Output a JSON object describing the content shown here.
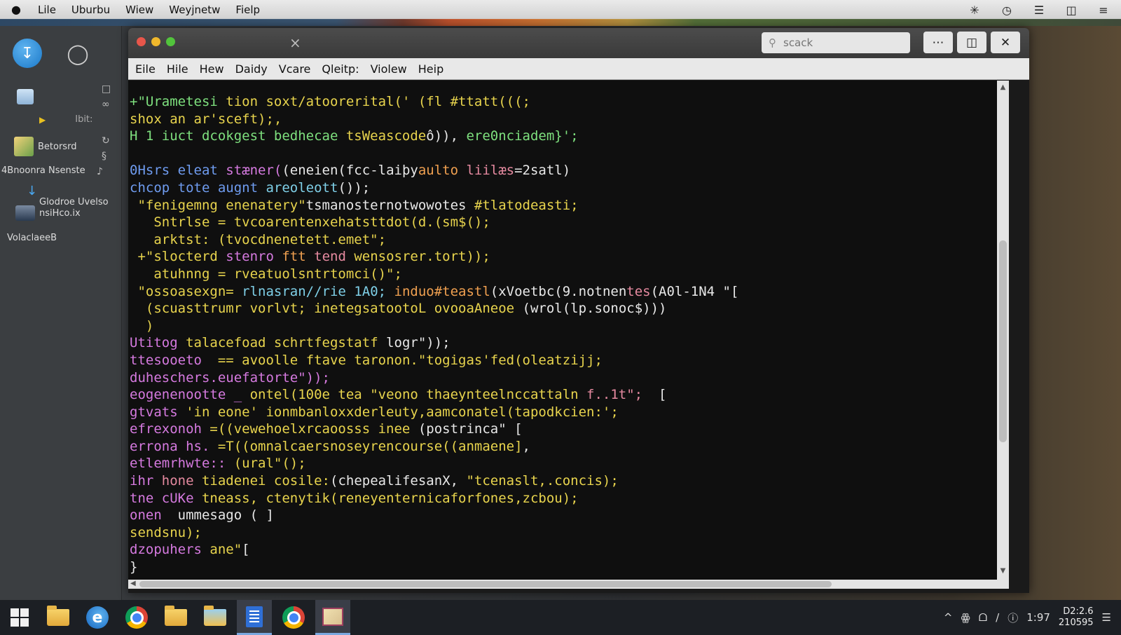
{
  "menubar": {
    "items": [
      "Lile",
      "Uburbu",
      "Wiew",
      "Weyjnetw",
      "Fielp"
    ]
  },
  "sidebar": {
    "items": [
      {
        "label": "Ibit:"
      },
      {
        "label": "Betorsrd"
      },
      {
        "label": "4Bnoonra Nsenste"
      },
      {
        "label": "Glodroe Uvelso"
      },
      {
        "label": "nsiHco.ix"
      },
      {
        "label": "VolaclaeeB"
      }
    ]
  },
  "window": {
    "search": {
      "placeholder": "scack"
    },
    "menu": [
      "Eile",
      "Hile",
      "Hew",
      "Daidy",
      "Vcare",
      "Qleitp:",
      "Violew",
      "Heip"
    ]
  },
  "code": {
    "lines": [
      [
        {
          "t": "+\"Urametesi ",
          "c": "g"
        },
        {
          "t": "tion ",
          "c": "y"
        },
        {
          "t": "soxt/atoorerital('",
          "c": "y"
        },
        {
          "t": " (fl #ttatt(((;",
          "c": "y"
        }
      ],
      [
        {
          "t": "shox an ar'sceft);,",
          "c": "y"
        }
      ],
      [
        {
          "t": "H 1 iuct ",
          "c": "g"
        },
        {
          "t": "dcokgest ",
          "c": "g"
        },
        {
          "t": "bedhecae ",
          "c": "g"
        },
        {
          "t": "tsWeascode",
          "c": "y"
        },
        {
          "t": "ô)), ",
          "c": "w"
        },
        {
          "t": "ere0nciadem}';",
          "c": "g"
        }
      ],
      [
        {
          "t": "",
          "c": "w"
        }
      ],
      [
        {
          "t": "0Hsrs eleat ",
          "c": "b"
        },
        {
          "t": "stæner(",
          "c": "m"
        },
        {
          "t": "(eneien(fcc-laiþy",
          "c": "w"
        },
        {
          "t": "aulto ",
          "c": "o"
        },
        {
          "t": "liilæs",
          "c": "p"
        },
        {
          "t": "=2satl)",
          "c": "w"
        }
      ],
      [
        {
          "t": "chcop ",
          "c": "b"
        },
        {
          "t": "tote augnt ",
          "c": "b"
        },
        {
          "t": "areoleott",
          "c": "c"
        },
        {
          "t": "());",
          "c": "w"
        }
      ],
      [
        {
          "t": " \"fenigemng ",
          "c": "y"
        },
        {
          "t": "enenatery\"",
          "c": "y"
        },
        {
          "t": "tsmanosternotwowotes ",
          "c": "w"
        },
        {
          "t": "#tlatodeasti;",
          "c": "y"
        }
      ],
      [
        {
          "t": "   Sntrlse = ",
          "c": "y"
        },
        {
          "t": "tvcoarentenxehatsttdot(d.(sm$();",
          "c": "y"
        }
      ],
      [
        {
          "t": "   arktst: ",
          "c": "y"
        },
        {
          "t": "(tvocdnenetett.emet\";",
          "c": "y"
        }
      ],
      [
        {
          "t": " +\"slocterd ",
          "c": "y"
        },
        {
          "t": "stenro ",
          "c": "m"
        },
        {
          "t": "ftt ",
          "c": "o"
        },
        {
          "t": "tend ",
          "c": "p"
        },
        {
          "t": "wensosrer.tort));",
          "c": "y"
        }
      ],
      [
        {
          "t": "   atuhnng = ",
          "c": "y"
        },
        {
          "t": "rveatuolsntrtomci()\";",
          "c": "y"
        }
      ],
      [
        {
          "t": " \"ossoasexgn= ",
          "c": "y"
        },
        {
          "t": "rlnasran//rie ",
          "c": "c"
        },
        {
          "t": "1A0; ",
          "c": "c"
        },
        {
          "t": "induo#teastl",
          "c": "o"
        },
        {
          "t": "(xVoetbc(9.notnen",
          "c": "w"
        },
        {
          "t": "tes",
          "c": "p"
        },
        {
          "t": "(A0l-1N4 \"[",
          "c": "w"
        }
      ],
      [
        {
          "t": "  (scuasttrumr ",
          "c": "y"
        },
        {
          "t": "vorlvt; ",
          "c": "y"
        },
        {
          "t": "inetegsatootoL ",
          "c": "y"
        },
        {
          "t": "ovooaAneoe ",
          "c": "y"
        },
        {
          "t": "(wrol(lp.sonoc$)))",
          "c": "w"
        }
      ],
      [
        {
          "t": "  )",
          "c": "y"
        }
      ],
      [
        {
          "t": "Utitog ",
          "c": "m"
        },
        {
          "t": "talacefoad ",
          "c": "y"
        },
        {
          "t": "schrtfegstatf ",
          "c": "y"
        },
        {
          "t": "logr\"));",
          "c": "w"
        }
      ],
      [
        {
          "t": "ttesooeto  ",
          "c": "m"
        },
        {
          "t": "== avoolle ",
          "c": "y"
        },
        {
          "t": "ftave ",
          "c": "y"
        },
        {
          "t": "taronon.",
          "c": "y"
        },
        {
          "t": "\"togigas",
          "c": "y"
        },
        {
          "t": "'fed(oleatzijj;",
          "c": "y"
        }
      ],
      [
        {
          "t": "duheschers.euefatorte\"));",
          "c": "m"
        }
      ],
      [
        {
          "t": "eogenenootte _ ",
          "c": "m"
        },
        {
          "t": "ontel(",
          "c": "y"
        },
        {
          "t": "100e tea ",
          "c": "y"
        },
        {
          "t": "\"veono ",
          "c": "y"
        },
        {
          "t": "thaeynteelnccattaln ",
          "c": "y"
        },
        {
          "t": "f..1t\";",
          "c": "p"
        },
        {
          "t": "  [",
          "c": "w"
        }
      ],
      [
        {
          "t": "gtvats ",
          "c": "m"
        },
        {
          "t": "'in eone' ",
          "c": "y"
        },
        {
          "t": "ionmbanloxxderleuty,",
          "c": "y"
        },
        {
          "t": "aamconatel(tapodkcien:';",
          "c": "y"
        }
      ],
      [
        {
          "t": "efrexonoh ",
          "c": "m"
        },
        {
          "t": "=((vewehoelxrcaoosss ",
          "c": "y"
        },
        {
          "t": "inee ",
          "c": "y"
        },
        {
          "t": "(postrinca\" [",
          "c": "w"
        }
      ],
      [
        {
          "t": "errona ",
          "c": "m"
        },
        {
          "t": "hs. ",
          "c": "m"
        },
        {
          "t": "=T((omnalcaersnoseyrencourse((anmaene]",
          "c": "y"
        },
        {
          "t": ",",
          "c": "w"
        }
      ],
      [
        {
          "t": "etlemrhwte:: ",
          "c": "m"
        },
        {
          "t": "(ural\"();",
          "c": "y"
        }
      ],
      [
        {
          "t": "ihr ",
          "c": "m"
        },
        {
          "t": "hone ",
          "c": "p"
        },
        {
          "t": "tiadenei ",
          "c": "y"
        },
        {
          "t": "cosile:",
          "c": "y"
        },
        {
          "t": "(chepealifesanX,",
          "c": "w"
        },
        {
          "t": " \"tcenaslt,.concis);",
          "c": "y"
        }
      ],
      [
        {
          "t": "tne ",
          "c": "m"
        },
        {
          "t": "cUKe ",
          "c": "m"
        },
        {
          "t": "tneass",
          "c": "y"
        },
        {
          "t": ", ctenytik(reneyenternicaforfones,zcbou);",
          "c": "y"
        }
      ],
      [
        {
          "t": "onen  ",
          "c": "m"
        },
        {
          "t": "ummesago ",
          "c": "w"
        },
        {
          "t": "( ]",
          "c": "w"
        }
      ],
      [
        {
          "t": "sendsnu);",
          "c": "y"
        }
      ],
      [
        {
          "t": "dzopuhers ",
          "c": "m"
        },
        {
          "t": "ane\"",
          "c": "y"
        },
        {
          "t": "[",
          "c": "w"
        }
      ],
      [
        {
          "t": "}",
          "c": "w"
        }
      ]
    ]
  },
  "taskbar": {
    "tray": [
      "^",
      "ꙮ",
      "ᗝ",
      "/",
      "ⓘ",
      "1:97"
    ],
    "clock": {
      "time": "D2:2.6",
      "date": "210595"
    }
  }
}
